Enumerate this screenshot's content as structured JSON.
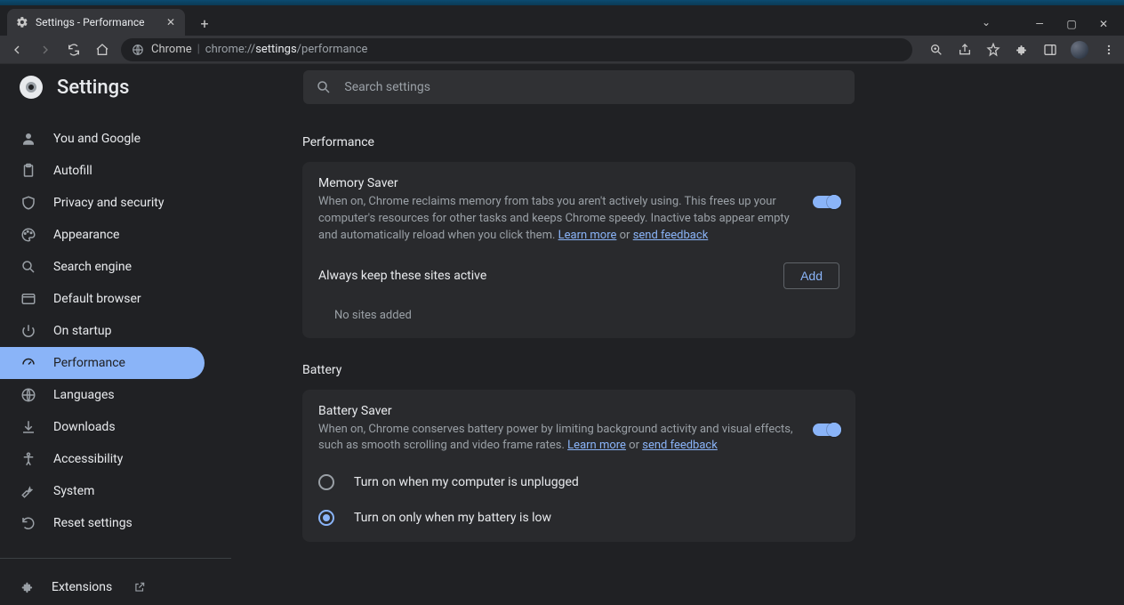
{
  "window": {
    "tab_title": "Settings - Performance"
  },
  "omnibox": {
    "product": "Chrome",
    "separator": "|",
    "url_prefix": "chrome://",
    "url_bold": "settings",
    "url_suffix": "/performance"
  },
  "header": {
    "title": "Settings",
    "search_placeholder": "Search settings"
  },
  "sidebar": {
    "items": [
      {
        "label": "You and Google"
      },
      {
        "label": "Autofill"
      },
      {
        "label": "Privacy and security"
      },
      {
        "label": "Appearance"
      },
      {
        "label": "Search engine"
      },
      {
        "label": "Default browser"
      },
      {
        "label": "On startup"
      },
      {
        "label": "Performance"
      },
      {
        "label": "Languages"
      },
      {
        "label": "Downloads"
      },
      {
        "label": "Accessibility"
      },
      {
        "label": "System"
      },
      {
        "label": "Reset settings"
      }
    ],
    "extensions_label": "Extensions"
  },
  "performance": {
    "section_title": "Performance",
    "memory_saver": {
      "title": "Memory Saver",
      "description": "When on, Chrome reclaims memory from tabs you aren't actively using. This frees up your computer's resources for other tasks and keeps Chrome speedy. Inactive tabs appear empty and automatically reload when you click them. ",
      "learn_more": "Learn more",
      "or": " or ",
      "send_feedback": "send feedback"
    },
    "always_active": {
      "label": "Always keep these sites active",
      "add_button": "Add",
      "empty": "No sites added"
    }
  },
  "battery": {
    "section_title": "Battery",
    "battery_saver": {
      "title": "Battery Saver",
      "description": "When on, Chrome conserves battery power by limiting background activity and visual effects, such as smooth scrolling and video frame rates. ",
      "learn_more": "Learn more",
      "or": " or ",
      "send_feedback": "send feedback"
    },
    "options": {
      "unplugged": "Turn on when my computer is unplugged",
      "low_battery": "Turn on only when my battery is low"
    }
  }
}
